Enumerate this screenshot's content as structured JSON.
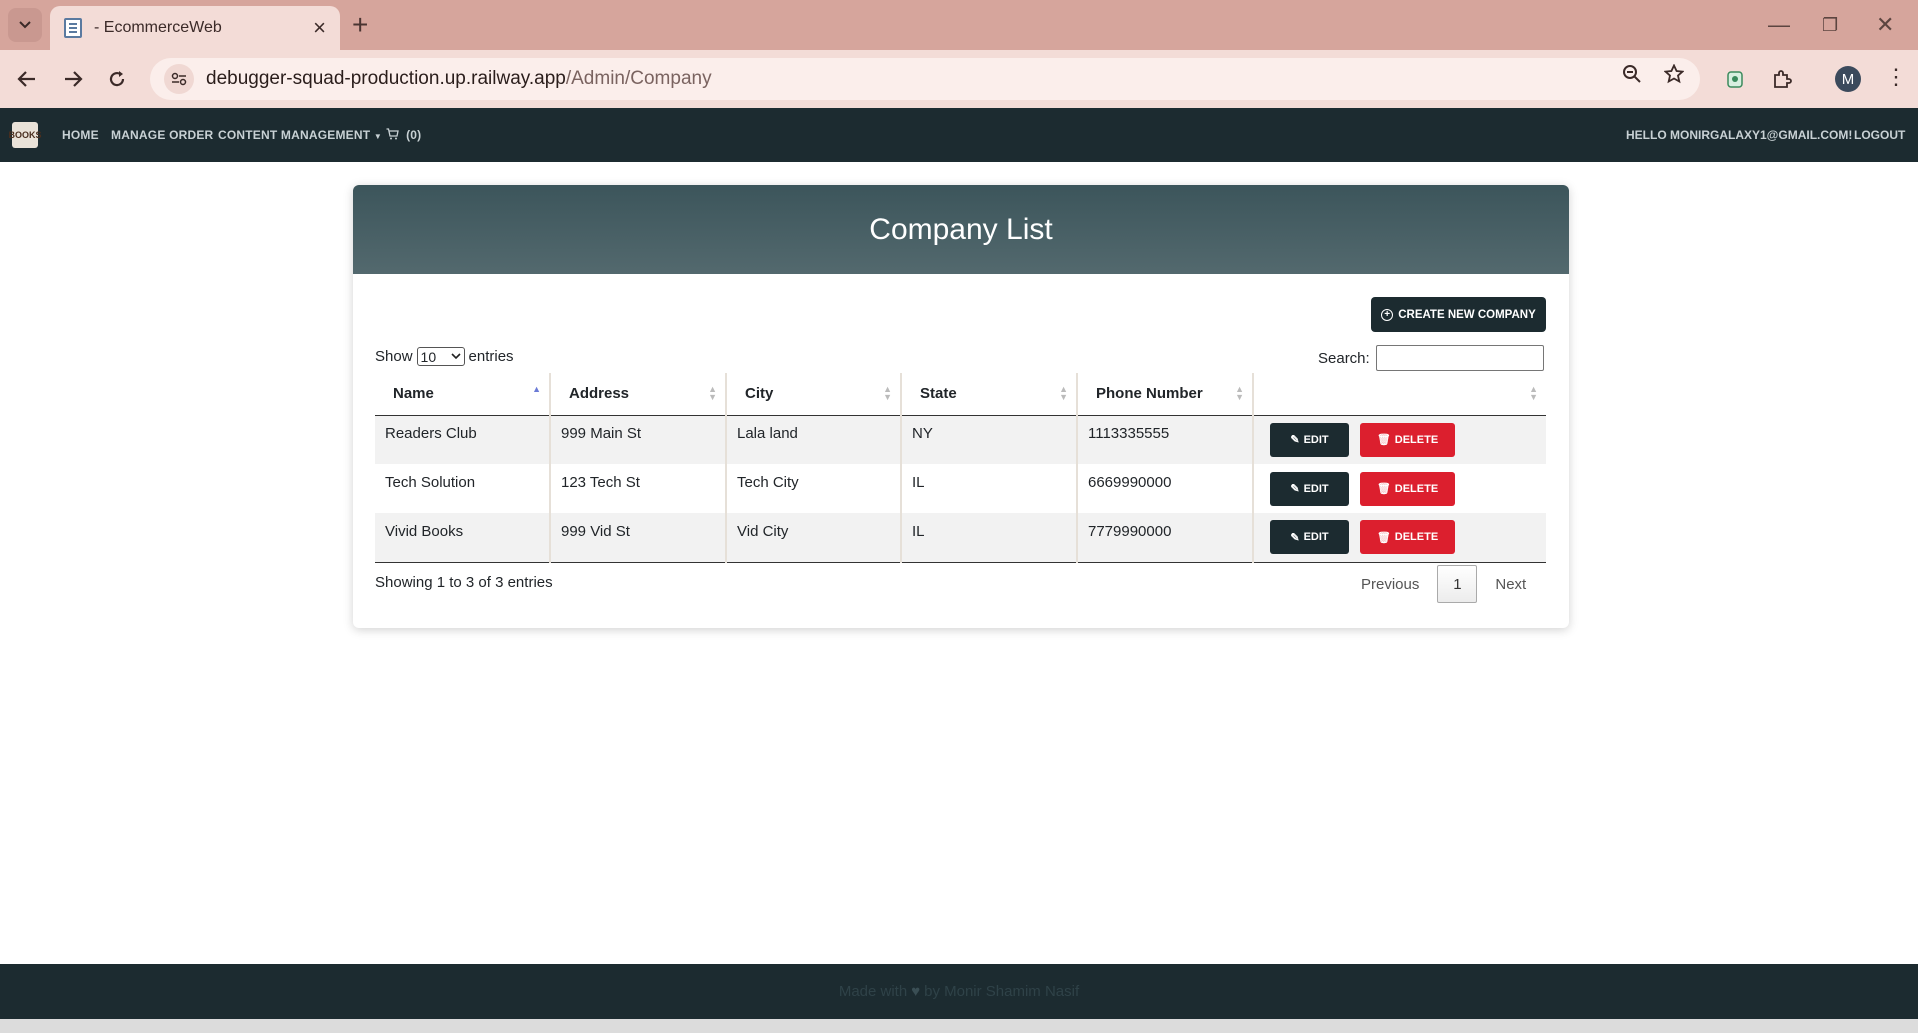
{
  "browser": {
    "tab_title": "- EcommerceWeb",
    "url_host": "debugger-squad-production.up.railway.app",
    "url_path": "/Admin/Company",
    "profile_initial": "M"
  },
  "navbar": {
    "logo_text": "BOOKS",
    "home": "HOME",
    "manage_order": "MANAGE ORDER",
    "content_management": "CONTENT MANAGEMENT",
    "cart_count": "(0)",
    "greeting": "HELLO MONIRGALAXY1@GMAIL.COM!",
    "logout": "LOGOUT"
  },
  "page": {
    "title": "Company List",
    "create_button": "CREATE NEW COMPANY"
  },
  "table_controls": {
    "show_label": "Show",
    "entries_value": "10",
    "entries_label": "entries",
    "search_label": "Search:",
    "search_value": ""
  },
  "table": {
    "headers": [
      "Name",
      "Address",
      "City",
      "State",
      "Phone Number",
      ""
    ],
    "rows": [
      {
        "name": "Readers Club",
        "address": "999 Main St",
        "city": "Lala land",
        "state": "NY",
        "phone": "1113335555"
      },
      {
        "name": "Tech Solution",
        "address": "123 Tech St",
        "city": "Tech City",
        "state": "IL",
        "phone": "6669990000"
      },
      {
        "name": "Vivid Books",
        "address": "999 Vid St",
        "city": "Vid City",
        "state": "IL",
        "phone": "7779990000"
      }
    ],
    "edit_label": "EDIT",
    "delete_label": "DELETE"
  },
  "pagination": {
    "info": "Showing 1 to 3 of 3 entries",
    "previous": "Previous",
    "current_page": "1",
    "next": "Next"
  },
  "footer": {
    "made_with": "Made with",
    "by_text": "by Monir Shamim Nasif"
  },
  "colors": {
    "navbar": "#1c2b30",
    "header_gradient_start": "#3c555b",
    "delete_red": "#dc1f2e",
    "browser_frame": "#d6a59c"
  }
}
